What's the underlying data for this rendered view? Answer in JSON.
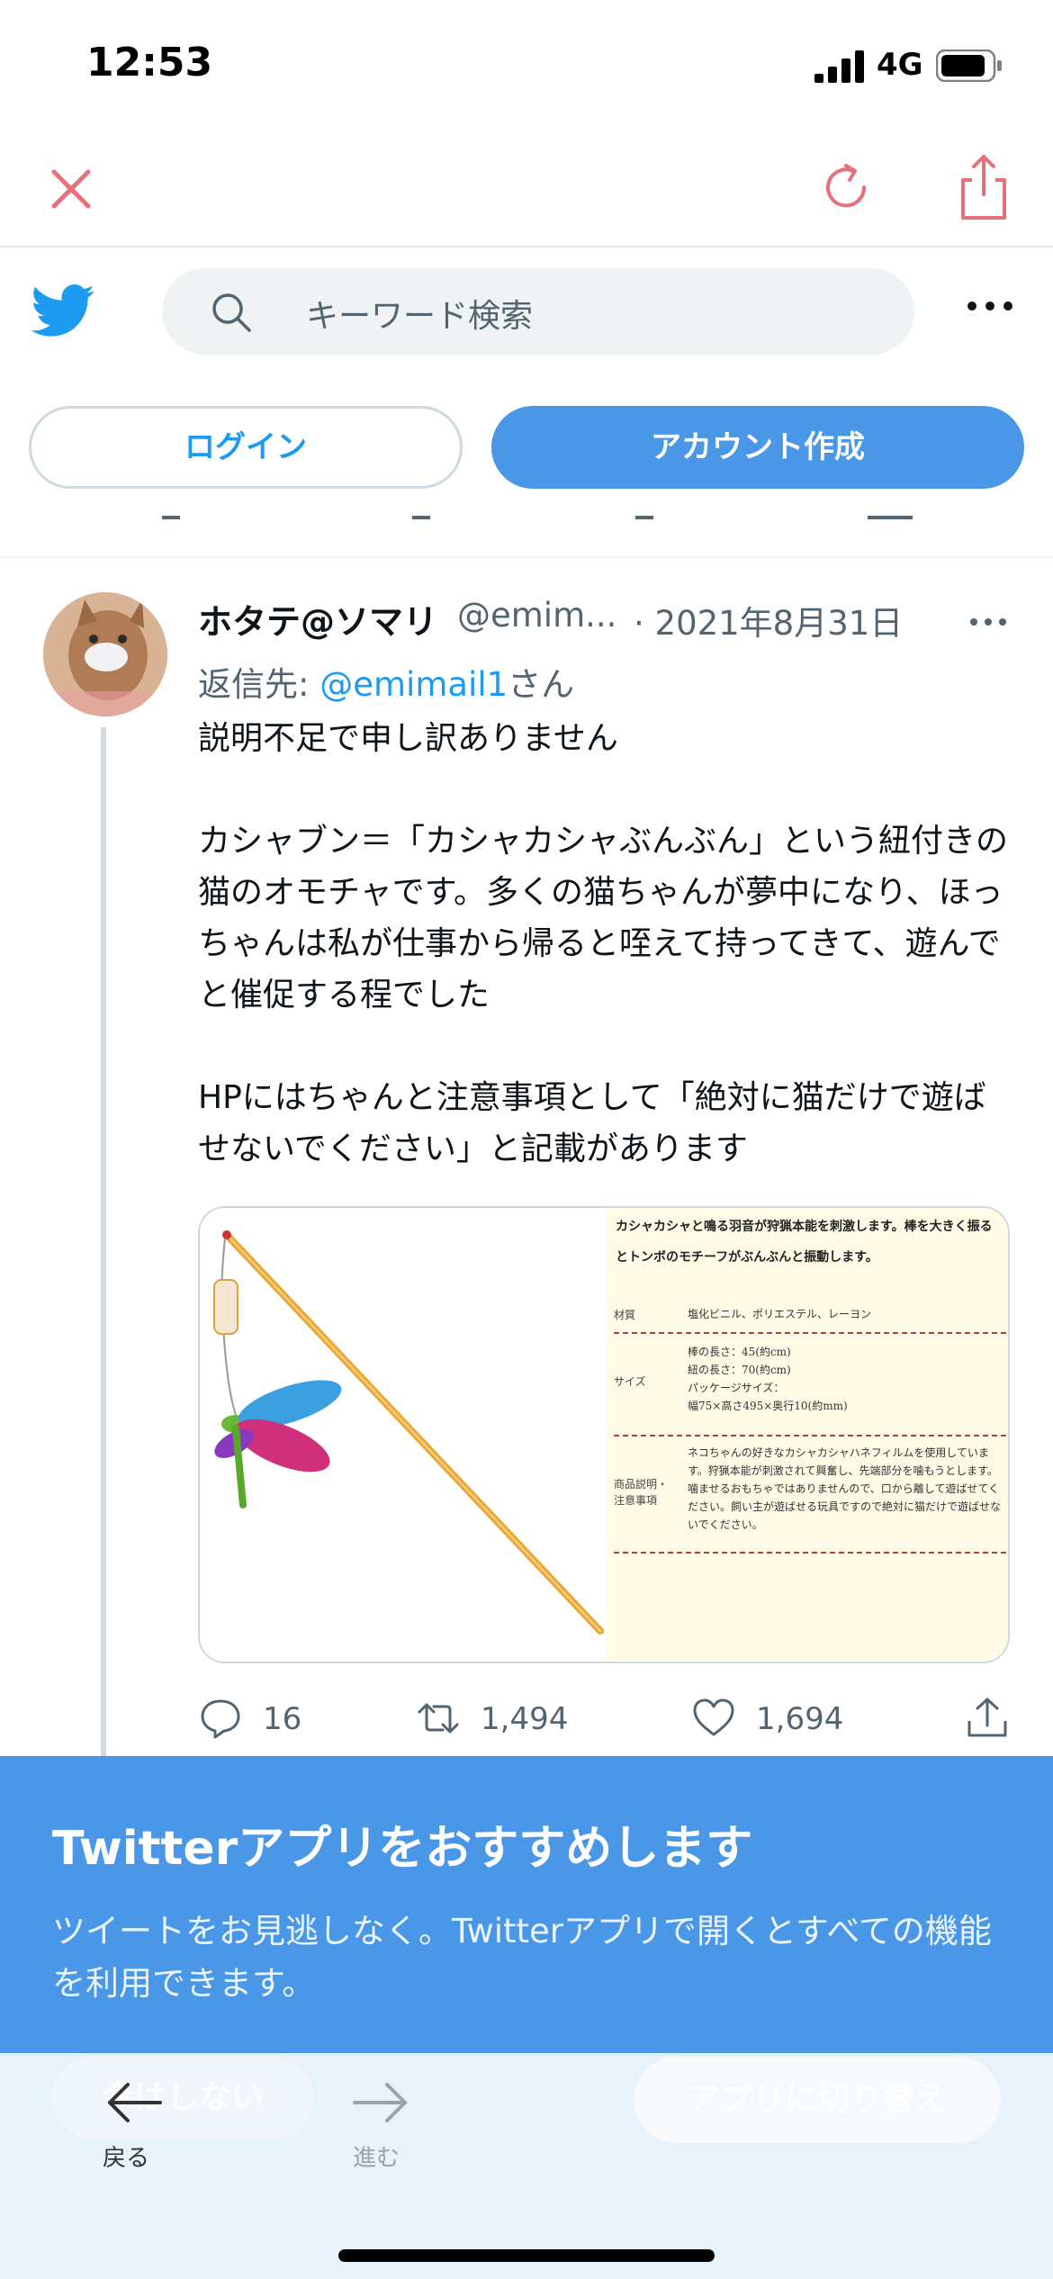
{
  "status_bar": {
    "time": "12:53",
    "network": "4G"
  },
  "browser": {
    "close_icon": "close-icon",
    "reload_icon": "reload-icon",
    "share_icon": "share-icon"
  },
  "header": {
    "search_placeholder": "キーワード検索",
    "login_label": "ログイン",
    "signup_label": "アカウント作成"
  },
  "tweet": {
    "name": "ホタテ@ソマリ",
    "handle": "@emim...",
    "date": "· 2021年8月31日",
    "reply_prefix": "返信先: ",
    "reply_to": "@emimail1",
    "reply_suffix": "さん",
    "body": "説明不足で申し訳ありません\n\nカシャブン＝「カシャカシャぶんぶん」という紐付きの猫のオモチャです。多くの猫ちゃんが夢中になり、ほっちゃんは私が仕事から帰ると咥えて持ってきて、遊んでと催促する程でした\n\nHPにはちゃんと注意事項として「絶対に猫だけで遊ばせないでください」と記載があります",
    "media": {
      "header_text": "カシャカシャと鳴る羽音が狩猟本能を刺激します。棒を大きく振るとトンボのモチーフがぶんぶんと振動します。",
      "rows": [
        {
          "label": "材質",
          "value": "塩化ビニル、ポリエステル、レーヨン"
        },
        {
          "label": "サイズ",
          "value": "棒の長さ：45(約cm)\n紐の長さ：70(約cm)\nパッケージサイズ：\n幅75×高さ495×奥行10(約mm)"
        },
        {
          "label": "商品説明・\n注意事項",
          "value": "ネコちゃんの好きなカシャカシャハネフィルムを使用しています。狩猟本能が刺激されて興奮し、先端部分を噛もうとします。噛ませるおもちゃではありませんので、口から離して遊ばせてください。飼い主が遊ばせる玩具ですので絶対に猫だけで遊ばせないでください。"
        }
      ]
    },
    "stats": {
      "replies": "16",
      "retweets": "1,494",
      "likes": "1,694"
    }
  },
  "promo": {
    "title": "Twitterアプリをおすすめします",
    "text": "ツイートをお見逃しなく。Twitterアプリで開くとすべての機能を利用できます。",
    "dismiss_label": "今はしない",
    "switch_label": "アプリに切り替え"
  },
  "nav": {
    "back_label": "戻る",
    "forward_label": "進む"
  },
  "colors": {
    "accent": "#1d9bf0",
    "promo_bg": "#4a97e8",
    "close_red": "#e8707a"
  }
}
